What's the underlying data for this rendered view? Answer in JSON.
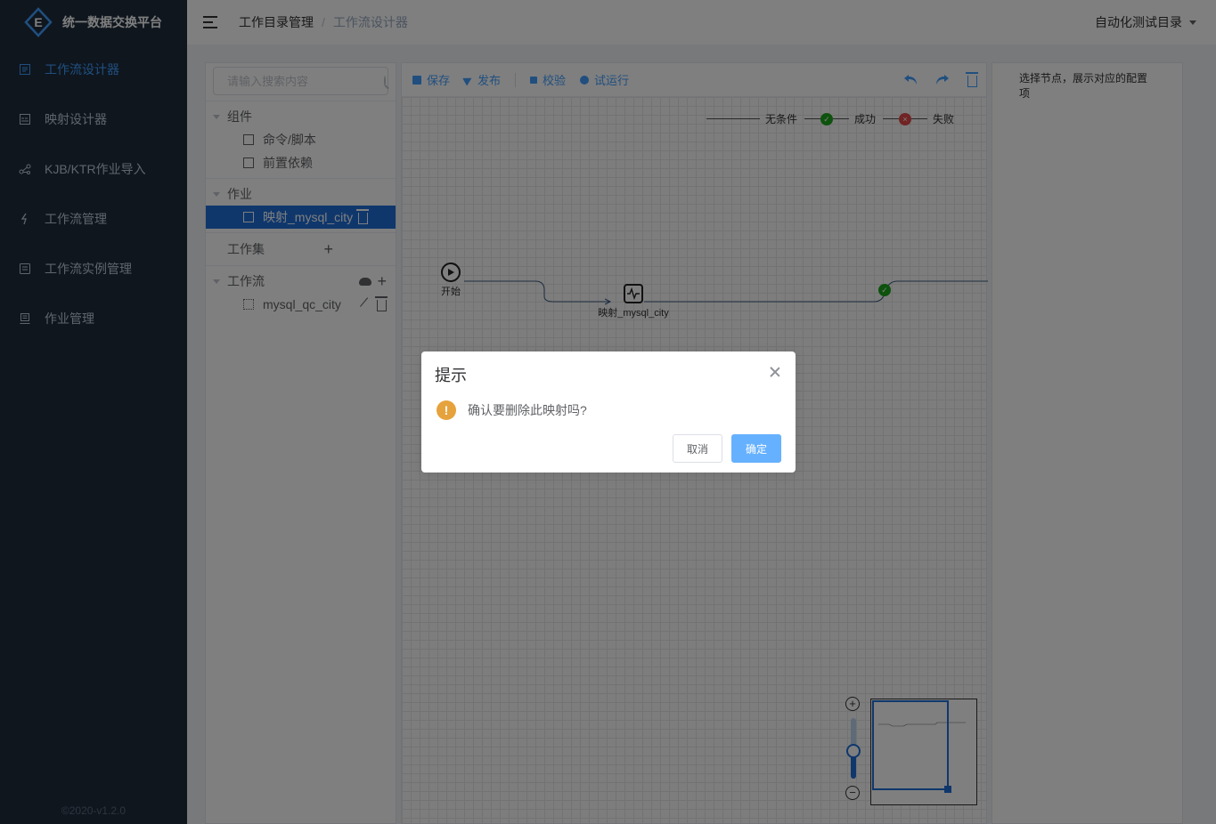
{
  "app": {
    "title": "统一数据交换平台",
    "logo_letter": "E",
    "copyright": "©2020-v1.2.0"
  },
  "sidebar": {
    "items": [
      {
        "label": "工作流设计器",
        "icon": "workflow-designer-icon",
        "active": true
      },
      {
        "label": "映射设计器",
        "icon": "mapping-designer-icon",
        "active": false
      },
      {
        "label": "KJB/KTR作业导入",
        "icon": "import-icon",
        "active": false
      },
      {
        "label": "工作流管理",
        "icon": "workflow-manage-icon",
        "active": false
      },
      {
        "label": "工作流实例管理",
        "icon": "instance-manage-icon",
        "active": false
      },
      {
        "label": "作业管理",
        "icon": "job-manage-icon",
        "active": false
      }
    ]
  },
  "header": {
    "breadcrumb": [
      "工作目录管理",
      "工作流设计器"
    ],
    "separator": "/",
    "directory_select": "自动化测试目录"
  },
  "tree": {
    "search_placeholder": "请输入搜索内容",
    "groups": {
      "components": {
        "label": "组件",
        "items": [
          "命令/脚本",
          "前置依赖"
        ]
      },
      "jobs": {
        "label": "作业",
        "items": [
          "映射_mysql_city"
        ]
      },
      "jobset": {
        "label": "工作集"
      },
      "workflows": {
        "label": "工作流",
        "items": [
          "mysql_qc_city"
        ]
      }
    }
  },
  "toolbar": {
    "save": "保存",
    "publish": "发布",
    "validate": "校验",
    "trial_run": "试运行"
  },
  "legend": {
    "unconditional": "无条件",
    "success": "成功",
    "fail": "失败"
  },
  "flow": {
    "start_label": "开始",
    "job_label": "映射_mysql_city"
  },
  "config_panel": {
    "hint": "选择节点，展示对应的配置项"
  },
  "zoom": {
    "level": 0.45
  },
  "dialog": {
    "title": "提示",
    "message": "确认要删除此映射吗?",
    "cancel": "取消",
    "confirm": "确定"
  },
  "colors": {
    "sidebar_bg": "#1f2d3d",
    "accent": "#409eff",
    "selected": "#1f6fd9",
    "warning": "#e6a23c",
    "success": "#1aa51a",
    "danger": "#e04848"
  }
}
